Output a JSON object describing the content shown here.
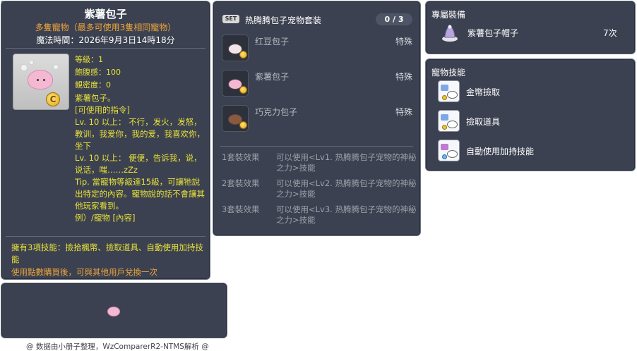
{
  "item": {
    "id": "05002764",
    "title": "紫薯包子",
    "subtitle": "多隻寵物（最多可使用3隻相同寵物）",
    "time": "魔法時間：2026年9月3日14時18分",
    "stats": {
      "level": "等級：1",
      "fullness": "飽腹感：100",
      "closeness": "親密度：0"
    },
    "desc": [
      "紫薯包子。",
      "[可使用的指令]",
      "Lv. 10 以上： 不行，发火，发怒，教训，我爱你，我的爱，我喜欢你，坐下",
      "Lv. 10 以上： 便便，告诉我，说，说话，嗤……zZz",
      "Tip. 當寵物等級達15級，可讓牠說出特定的內容。寵物說的話不會讓其他玩家看到。",
      "例）/寵物 [內容]"
    ],
    "skills_text": "擁有3項技能：撿拾楓幣、撿取道具、自動使用加持技能",
    "trade_text": "使用點數購買後，可與其他用戶兌換一次",
    "coin_symbol": "C"
  },
  "footer": "@ 数据由小册子整理，WzComparerR2-NTMS解析 @",
  "set": {
    "badge": "SET",
    "title": "热腾腾包子宠物套装",
    "count": "0 / 3",
    "items": [
      {
        "name": "红豆包子",
        "tag": "特殊",
        "color": "#f0e6ea"
      },
      {
        "name": "紫薯包子",
        "tag": "特殊",
        "color": "#f4b8d2"
      },
      {
        "name": "巧克力包子",
        "tag": "特殊",
        "color": "#8b5a3c"
      }
    ],
    "effects": [
      {
        "label": "1套裝效果",
        "text": "可以使用<Lv1. 热腾腾包子宠物的神秘之力>技能"
      },
      {
        "label": "2套裝效果",
        "text": "可以使用<Lv2. 热腾腾包子宠物的神秘之力>技能"
      },
      {
        "label": "3套裝效果",
        "text": "可以使用<Lv3. 热腾腾包子宠物的神秘之力>技能"
      }
    ]
  },
  "equip": {
    "heading": "專屬裝備",
    "icon": "pet-hat-icon",
    "name": "紫薯包子帽子",
    "count": "7次"
  },
  "pet_skills": {
    "heading": "寵物技能",
    "items": [
      {
        "name": "金幣撿取",
        "icon": "pickup-meso-icon"
      },
      {
        "name": "撿取道具",
        "icon": "pickup-item-icon"
      },
      {
        "name": "自動使用加持技能",
        "icon": "auto-buff-icon"
      }
    ]
  }
}
